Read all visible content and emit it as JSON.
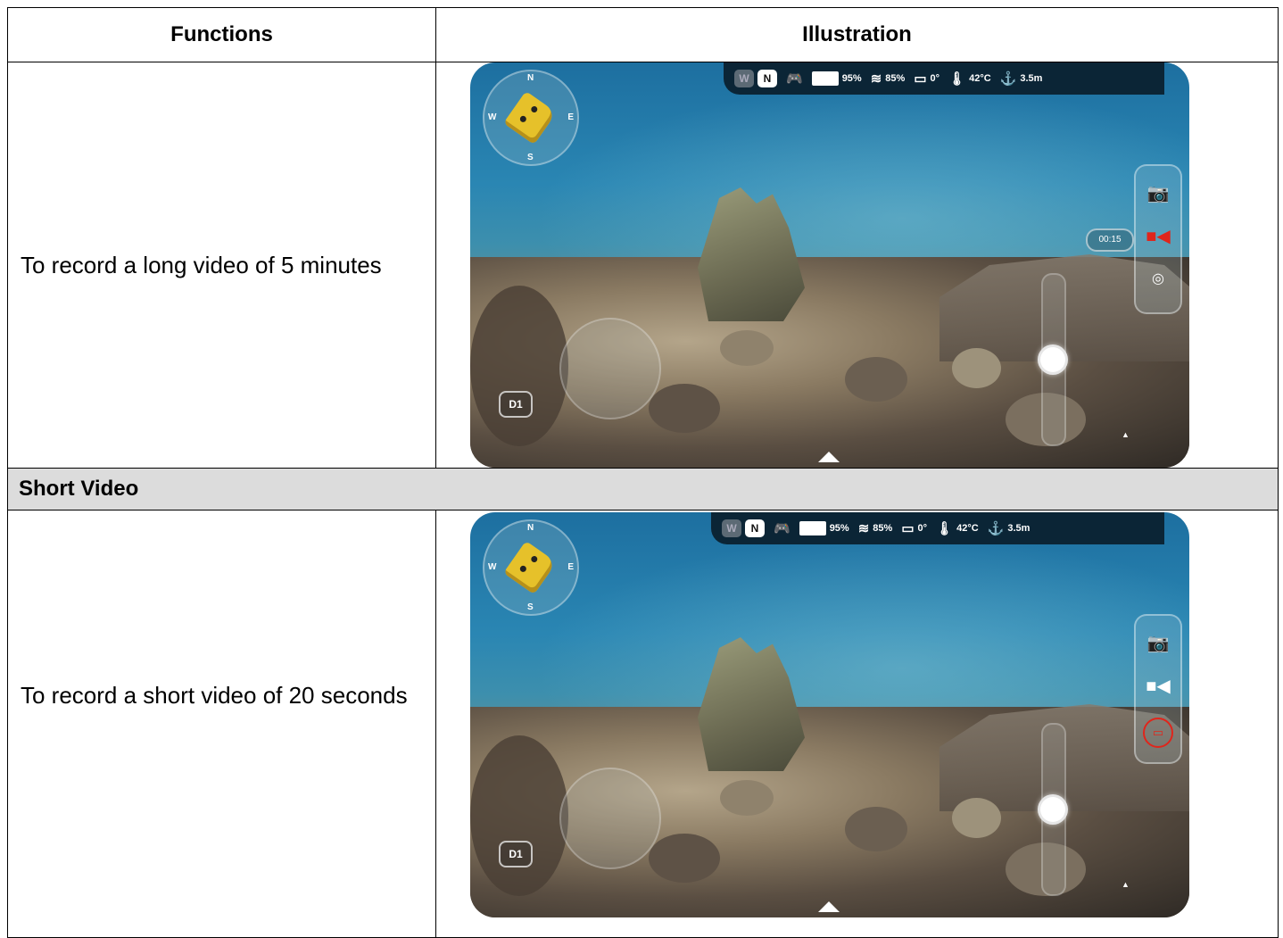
{
  "table": {
    "header": {
      "functions": "Functions",
      "illustration": "Illustration"
    },
    "rows": [
      {
        "function_text": "To record a long video of 5 minutes"
      },
      {
        "function_text": "To record a short video of 20 seconds"
      }
    ],
    "section_title": "Short Video"
  },
  "hud": {
    "compass": {
      "n": "N",
      "w": "W",
      "e": "E",
      "s": "S"
    },
    "mode_w": "W",
    "mode_n": "N",
    "controller_icon": "gamepad-icon",
    "drone_battery": "95%",
    "signal": "85%",
    "tilt": "0°",
    "temperature": "42°C",
    "depth": "3.5m",
    "timer": "00:15",
    "depth_mode": "D1",
    "accent": "#e0251b"
  }
}
